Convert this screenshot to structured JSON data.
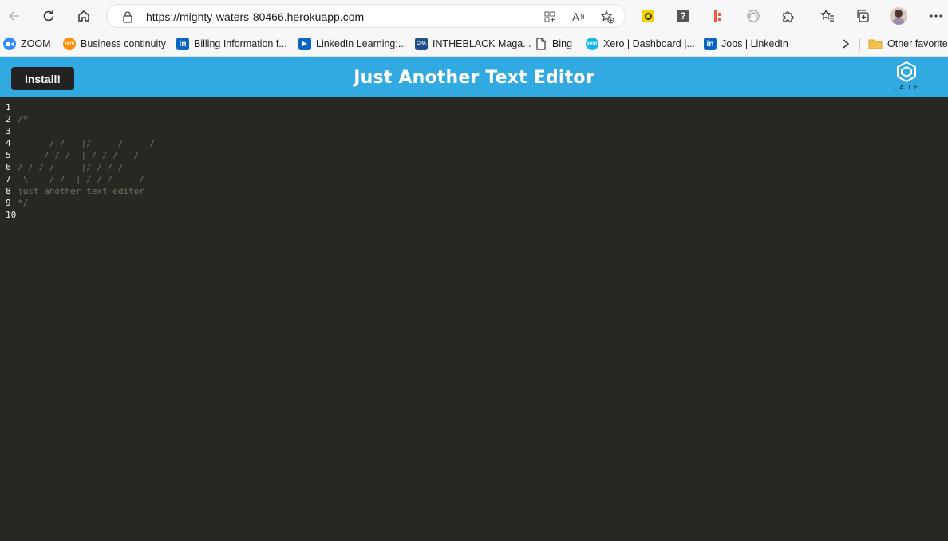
{
  "browser": {
    "url": "https://mighty-waters-80466.herokuapp.com",
    "profile_initials": ""
  },
  "favorites": [
    {
      "label": "ZOOM",
      "icon": "zoom-icon",
      "color": "#2d8cff"
    },
    {
      "label": "Business continuity",
      "icon": "xero-icon",
      "color": "#ff8c00"
    },
    {
      "label": "Billing Information f...",
      "icon": "linkedin-icon",
      "color": "#0a66c2"
    },
    {
      "label": "LinkedIn Learning:...",
      "icon": "linkedin-learning-icon",
      "color": "#0a66c2"
    },
    {
      "label": "INTHEBLACK Maga...",
      "icon": "cpa-icon",
      "color": "#1f4e8c"
    },
    {
      "label": "Bing",
      "icon": "page-icon",
      "color": "#ffffff"
    },
    {
      "label": "Xero | Dashboard |...",
      "icon": "xero-icon",
      "color": "#13b5ea"
    },
    {
      "label": "Jobs | LinkedIn",
      "icon": "linkedin-icon",
      "color": "#0a66c2"
    }
  ],
  "other_favorites": "Other favorites",
  "app": {
    "install_label": "Install!",
    "title": "Just Another Text Editor",
    "logo_text": "J.A.T.E",
    "header_color": "#31a9e1"
  },
  "editor": {
    "line_numbers": [
      "1",
      "2",
      "3",
      "4",
      "5",
      "6",
      "7",
      "8",
      "9",
      "10"
    ],
    "lines": [
      "",
      "/*",
      "       _____  _____________",
      "      / /   |/_  __/ ____/",
      " __  / / /| | / / / __/",
      "/ /_/ / ___ |/ / / /___",
      " \\____/_/  |_/_/ /_____/",
      "just another text editor",
      "*/",
      ""
    ]
  }
}
